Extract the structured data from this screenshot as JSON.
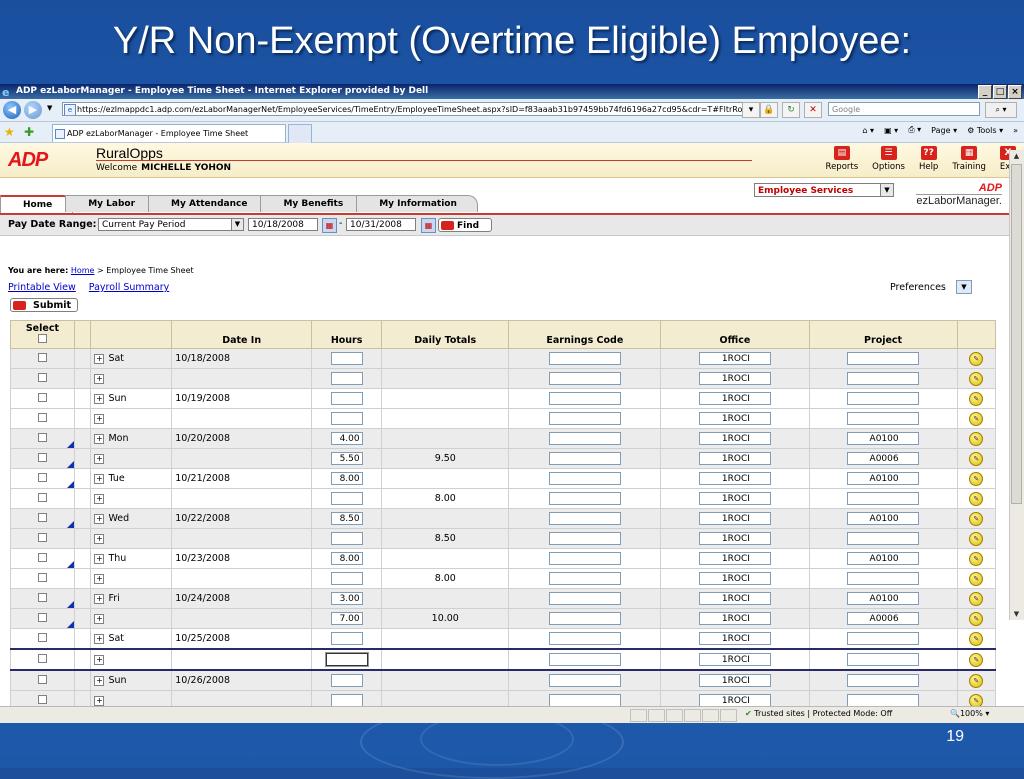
{
  "slide": {
    "title": "Y/R Non-Exempt (Overtime Eligible) Employee:",
    "page_number": "19"
  },
  "browser": {
    "window_title": "ADP ezLaborManager - Employee Time Sheet - Internet Explorer provided by Dell",
    "url": "https://ezlmappdc1.adp.com/ezLaborManagerNet/EmployeeServices/TimeEntry/EmployeeTimeSheet.aspx?sID=f83aaab31b97459bb74fd6196a27cd95&cdr=T#FltrRow",
    "search_placeholder": "Google",
    "tab_label": "ADP ezLaborManager - Employee Time Sheet",
    "cmd_page": "Page",
    "cmd_tools": "Tools",
    "status_trusted": "Trusted sites | Protected Mode: Off",
    "zoom": "100%"
  },
  "app": {
    "logo": "ADP",
    "company": "RuralOpps",
    "welcome_label": "Welcome",
    "user_name": "MICHELLE YOHON",
    "tools": [
      {
        "label": "Reports"
      },
      {
        "label": "Options"
      },
      {
        "label": "Help"
      },
      {
        "label": "Training"
      },
      {
        "label": "Exit"
      }
    ],
    "services_select": "Employee Services",
    "brand_small": "ADP",
    "brand_name": "ezLaborManager.",
    "tabs": [
      {
        "label": "Home"
      },
      {
        "label": "My Labor"
      },
      {
        "label": "My Attendance"
      },
      {
        "label": "My Benefits"
      },
      {
        "label": "My Information"
      }
    ]
  },
  "filter": {
    "label": "Pay Date Range:",
    "period": "Current Pay Period",
    "start": "10/18/2008",
    "end": "10/31/2008",
    "find": "Find"
  },
  "breadcrumb": {
    "prefix": "You are here:",
    "home": "Home",
    "current": "> Employee Time Sheet"
  },
  "links": {
    "printable": "Printable View",
    "payroll": "Payroll Summary",
    "preferences": "Preferences",
    "submit": "Submit"
  },
  "table": {
    "headers": {
      "select": "Select",
      "date_in": "Date In",
      "hours": "Hours",
      "daily_totals": "Daily Totals",
      "earnings_code": "Earnings Code",
      "office": "Office",
      "project": "Project"
    },
    "rows": [
      {
        "day": "Sat",
        "date": "10/18/2008",
        "hours": "",
        "total": "",
        "office": "1ROCI",
        "project": "",
        "marker": false
      },
      {
        "day": "",
        "date": "",
        "hours": "",
        "total": "",
        "office": "1ROCI",
        "project": "",
        "marker": false
      },
      {
        "day": "Sun",
        "date": "10/19/2008",
        "hours": "",
        "total": "",
        "office": "1ROCI",
        "project": "",
        "marker": false
      },
      {
        "day": "",
        "date": "",
        "hours": "",
        "total": "",
        "office": "1ROCI",
        "project": "",
        "marker": false
      },
      {
        "day": "Mon",
        "date": "10/20/2008",
        "hours": "4.00",
        "total": "",
        "office": "1ROCI",
        "project": "A0100",
        "marker": true
      },
      {
        "day": "",
        "date": "",
        "hours": "5.50",
        "total": "9.50",
        "office": "1ROCI",
        "project": "A0006",
        "marker": true
      },
      {
        "day": "Tue",
        "date": "10/21/2008",
        "hours": "8.00",
        "total": "",
        "office": "1ROCI",
        "project": "A0100",
        "marker": true
      },
      {
        "day": "",
        "date": "",
        "hours": "",
        "total": "8.00",
        "office": "1ROCI",
        "project": "",
        "marker": false
      },
      {
        "day": "Wed",
        "date": "10/22/2008",
        "hours": "8.50",
        "total": "",
        "office": "1ROCI",
        "project": "A0100",
        "marker": true
      },
      {
        "day": "",
        "date": "",
        "hours": "",
        "total": "8.50",
        "office": "1ROCI",
        "project": "",
        "marker": false
      },
      {
        "day": "Thu",
        "date": "10/23/2008",
        "hours": "8.00",
        "total": "",
        "office": "1ROCI",
        "project": "A0100",
        "marker": true
      },
      {
        "day": "",
        "date": "",
        "hours": "",
        "total": "8.00",
        "office": "1ROCI",
        "project": "",
        "marker": false
      },
      {
        "day": "Fri",
        "date": "10/24/2008",
        "hours": "3.00",
        "total": "",
        "office": "1ROCI",
        "project": "A0100",
        "marker": true
      },
      {
        "day": "",
        "date": "",
        "hours": "7.00",
        "total": "10.00",
        "office": "1ROCI",
        "project": "A0006",
        "marker": true
      },
      {
        "day": "Sat",
        "date": "10/25/2008",
        "hours": "",
        "total": "",
        "office": "1ROCI",
        "project": "",
        "marker": false
      },
      {
        "day": "",
        "date": "",
        "hours": "",
        "total": "",
        "office": "1ROCI",
        "project": "",
        "marker": false
      },
      {
        "day": "Sun",
        "date": "10/26/2008",
        "hours": "",
        "total": "",
        "office": "1ROCI",
        "project": "",
        "marker": false
      },
      {
        "day": "",
        "date": "",
        "hours": "",
        "total": "",
        "office": "1ROCI",
        "project": "",
        "marker": false
      }
    ]
  }
}
